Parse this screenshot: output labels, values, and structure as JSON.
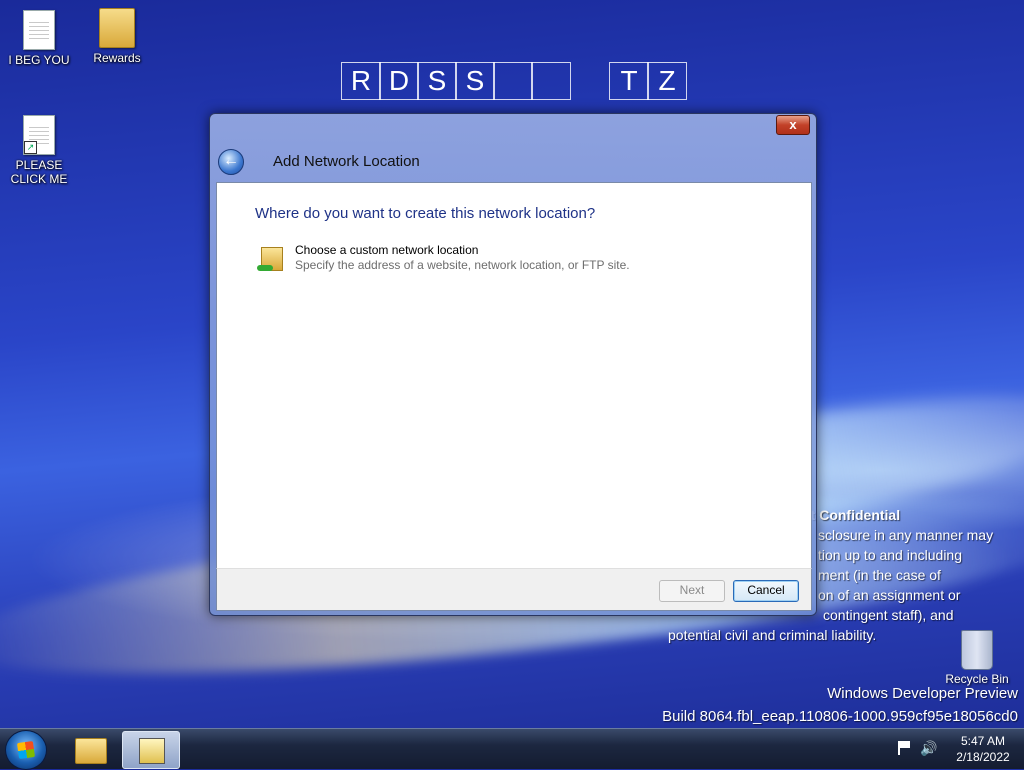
{
  "desktop": {
    "icons": [
      {
        "label": "I BEG YOU"
      },
      {
        "label": "Rewards"
      },
      {
        "label": "PLEASE CLICK ME"
      }
    ],
    "grid_letters": [
      "R",
      "D",
      "S",
      "S",
      "",
      "",
      "T",
      "Z"
    ],
    "confidential": {
      "title": "ft Confidential",
      "lines": [
        "sclosure in any manner may",
        "tion up to and including",
        "ment (in the case of",
        "on of an assignment or",
        "contingent staff), and",
        "potential civil and criminal liability."
      ]
    },
    "watermark_line1": "Windows Developer Preview",
    "watermark_line2": "Build 8064.fbl_eeap.110806-1000.959cf95e18056cd0",
    "recycle_bin_label": "Recycle Bin"
  },
  "dialog": {
    "close_label": "x",
    "title": "Add Network Location",
    "heading": "Where do you want to create this network location?",
    "option_title": "Choose a custom network location",
    "option_description": "Specify the address of a website, network location, or FTP site.",
    "next_label": "Next",
    "cancel_label": "Cancel"
  },
  "taskbar": {
    "time": "5:47 AM",
    "date": "2/18/2022"
  },
  "colors": {
    "heading_blue": "#1e3287",
    "close_red": "#c24128",
    "wallpaper_blue": "#2a45c8"
  }
}
